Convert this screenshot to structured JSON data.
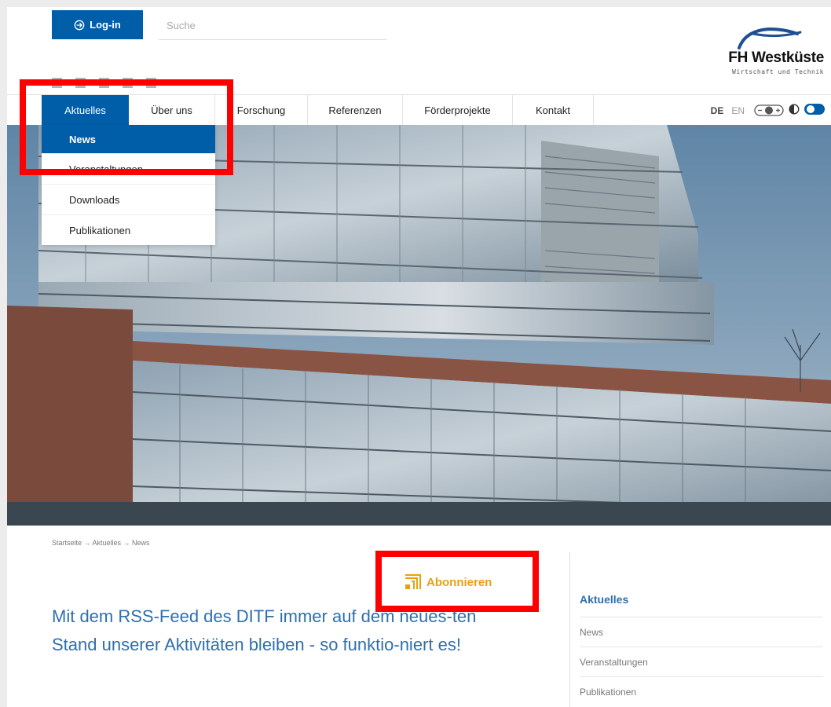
{
  "header": {
    "login_label": "Log-in",
    "search_placeholder": "Suche"
  },
  "logo": {
    "name": "FH Westküste",
    "tagline": "Wirtschaft und Technik"
  },
  "nav": {
    "items": [
      {
        "label": "Aktuelles",
        "active": true
      },
      {
        "label": "Über uns"
      },
      {
        "label": "Forschung"
      },
      {
        "label": "Referenzen"
      },
      {
        "label": "Förderprojekte"
      },
      {
        "label": "Kontakt"
      }
    ],
    "lang_de": "DE",
    "lang_en": "EN"
  },
  "dropdown": {
    "items": [
      {
        "label": "News",
        "active": true
      },
      {
        "label": "Veranstaltungen"
      },
      {
        "label": "Downloads"
      },
      {
        "label": "Publikationen"
      }
    ]
  },
  "breadcrumb": "Startseite → Aktuelles → News",
  "subscribe_label": "Abonnieren",
  "headline": "Mit dem RSS-Feed des DITF immer auf dem neues-ten Stand unserer Aktivitäten bleiben - so funktio-niert es!",
  "sidebar": {
    "title": "Aktuelles",
    "items": [
      "News",
      "Veranstaltungen",
      "Publikationen"
    ]
  },
  "colors": {
    "primary": "#005ea8",
    "accent": "#e8a013",
    "heading": "#2e6fae",
    "annotation": "#ff0000"
  },
  "icons": {
    "login": "login-arrow-icon",
    "subscribe": "rss-feed-icon",
    "accessibility": "font-size-icon",
    "contrast": "contrast-toggle-icon"
  }
}
